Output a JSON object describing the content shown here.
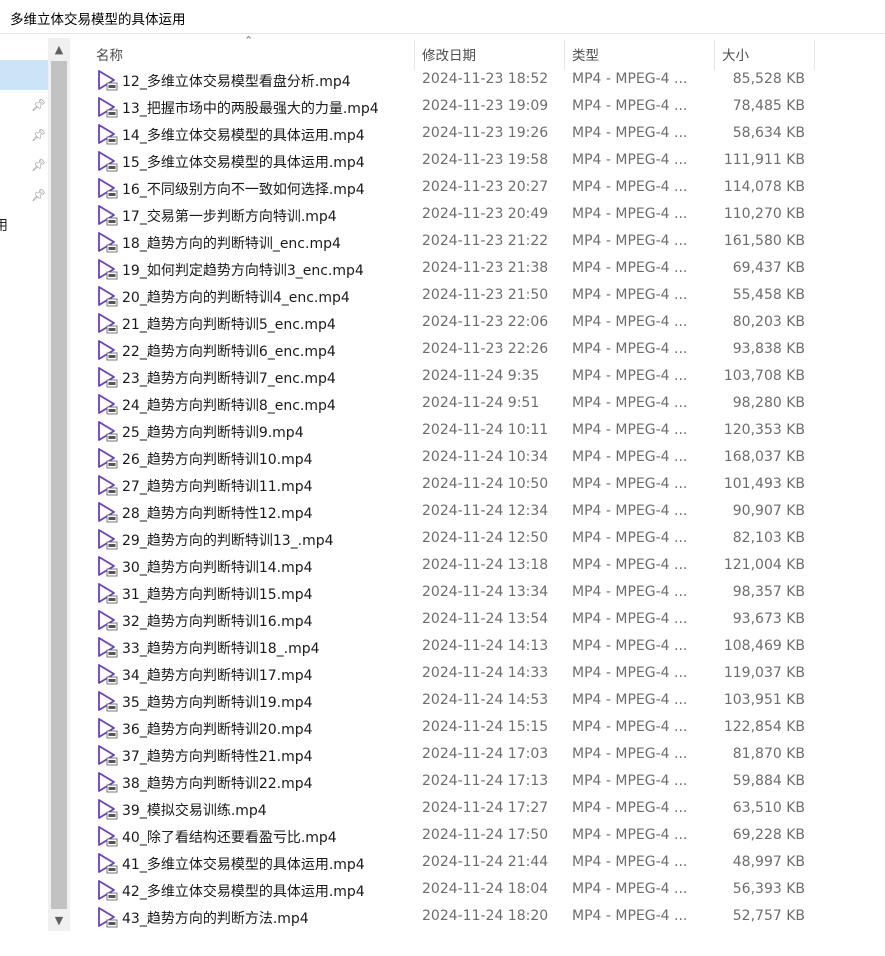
{
  "window": {
    "title": "多维立体交易模型的具体运用"
  },
  "nav": {
    "partial_label": "用"
  },
  "columns": {
    "name": "名称",
    "date": "修改日期",
    "type": "类型",
    "size": "大小"
  },
  "icons": {
    "file": "video-file-icon",
    "accent": "#6a3fc9",
    "pin": "pin-icon",
    "sort": "sort-up-icon"
  },
  "files": [
    {
      "name": "12_多维立体交易模型看盘分析.mp4",
      "date": "2024-11-23 18:52",
      "type": "MP4 - MPEG-4 ...",
      "size": "85,528 KB"
    },
    {
      "name": "13_把握市场中的两股最强大的力量.mp4",
      "date": "2024-11-23 19:09",
      "type": "MP4 - MPEG-4 ...",
      "size": "78,485 KB"
    },
    {
      "name": "14_多维立体交易模型的具体运用.mp4",
      "date": "2024-11-23 19:26",
      "type": "MP4 - MPEG-4 ...",
      "size": "58,634 KB"
    },
    {
      "name": "15_多维立体交易模型的具体运用.mp4",
      "date": "2024-11-23 19:58",
      "type": "MP4 - MPEG-4 ...",
      "size": "111,911 KB"
    },
    {
      "name": "16_不同级别方向不一致如何选择.mp4",
      "date": "2024-11-23 20:27",
      "type": "MP4 - MPEG-4 ...",
      "size": "114,078 KB"
    },
    {
      "name": "17_交易第一步判断方向特训.mp4",
      "date": "2024-11-23 20:49",
      "type": "MP4 - MPEG-4 ...",
      "size": "110,270 KB"
    },
    {
      "name": "18_趋势方向的判断特训_enc.mp4",
      "date": "2024-11-23 21:22",
      "type": "MP4 - MPEG-4 ...",
      "size": "161,580 KB"
    },
    {
      "name": "19_如何判定趋势方向特训3_enc.mp4",
      "date": "2024-11-23 21:38",
      "type": "MP4 - MPEG-4 ...",
      "size": "69,437 KB"
    },
    {
      "name": "20_趋势方向的判断特训4_enc.mp4",
      "date": "2024-11-23 21:50",
      "type": "MP4 - MPEG-4 ...",
      "size": "55,458 KB"
    },
    {
      "name": "21_趋势方向判断特训5_enc.mp4",
      "date": "2024-11-23 22:06",
      "type": "MP4 - MPEG-4 ...",
      "size": "80,203 KB"
    },
    {
      "name": "22_趋势方向判断特训6_enc.mp4",
      "date": "2024-11-23 22:26",
      "type": "MP4 - MPEG-4 ...",
      "size": "93,838 KB"
    },
    {
      "name": "23_趋势方向判断特训7_enc.mp4",
      "date": "2024-11-24 9:35",
      "type": "MP4 - MPEG-4 ...",
      "size": "103,708 KB"
    },
    {
      "name": "24_趋势方向判断特训8_enc.mp4",
      "date": "2024-11-24 9:51",
      "type": "MP4 - MPEG-4 ...",
      "size": "98,280 KB"
    },
    {
      "name": "25_趋势方向判断特训9.mp4",
      "date": "2024-11-24 10:11",
      "type": "MP4 - MPEG-4 ...",
      "size": "120,353 KB"
    },
    {
      "name": "26_趋势方向判断特训10.mp4",
      "date": "2024-11-24 10:34",
      "type": "MP4 - MPEG-4 ...",
      "size": "168,037 KB"
    },
    {
      "name": "27_趋势方向判断特训11.mp4",
      "date": "2024-11-24 10:50",
      "type": "MP4 - MPEG-4 ...",
      "size": "101,493 KB"
    },
    {
      "name": "28_趋势方向判断特性12.mp4",
      "date": "2024-11-24 12:34",
      "type": "MP4 - MPEG-4 ...",
      "size": "90,907 KB"
    },
    {
      "name": "29_趋势方向的判断特训13_.mp4",
      "date": "2024-11-24 12:50",
      "type": "MP4 - MPEG-4 ...",
      "size": "82,103 KB"
    },
    {
      "name": "30_趋势方向判断特训14.mp4",
      "date": "2024-11-24 13:18",
      "type": "MP4 - MPEG-4 ...",
      "size": "121,004 KB"
    },
    {
      "name": "31_趋势方向判断特训15.mp4",
      "date": "2024-11-24 13:34",
      "type": "MP4 - MPEG-4 ...",
      "size": "98,357 KB"
    },
    {
      "name": "32_趋势方向判断特训16.mp4",
      "date": "2024-11-24 13:54",
      "type": "MP4 - MPEG-4 ...",
      "size": "93,673 KB"
    },
    {
      "name": "33_趋势方向判断特训18_.mp4",
      "date": "2024-11-24 14:13",
      "type": "MP4 - MPEG-4 ...",
      "size": "108,469 KB"
    },
    {
      "name": "34_趋势方向判断特训17.mp4",
      "date": "2024-11-24 14:33",
      "type": "MP4 - MPEG-4 ...",
      "size": "119,037 KB"
    },
    {
      "name": "35_趋势方向判断特训19.mp4",
      "date": "2024-11-24 14:53",
      "type": "MP4 - MPEG-4 ...",
      "size": "103,951 KB"
    },
    {
      "name": "36_趋势方向判断特训20.mp4",
      "date": "2024-11-24 15:15",
      "type": "MP4 - MPEG-4 ...",
      "size": "122,854 KB"
    },
    {
      "name": "37_趋势方向判断特性21.mp4",
      "date": "2024-11-24 17:03",
      "type": "MP4 - MPEG-4 ...",
      "size": "81,870 KB"
    },
    {
      "name": "38_趋势方向判断特训22.mp4",
      "date": "2024-11-24 17:13",
      "type": "MP4 - MPEG-4 ...",
      "size": "59,884 KB"
    },
    {
      "name": "39_模拟交易训练.mp4",
      "date": "2024-11-24 17:27",
      "type": "MP4 - MPEG-4 ...",
      "size": "63,510 KB"
    },
    {
      "name": "40_除了看结构还要看盈亏比.mp4",
      "date": "2024-11-24 17:50",
      "type": "MP4 - MPEG-4 ...",
      "size": "69,228 KB"
    },
    {
      "name": "41_多维立体交易模型的具体运用.mp4",
      "date": "2024-11-24 21:44",
      "type": "MP4 - MPEG-4 ...",
      "size": "48,997 KB"
    },
    {
      "name": "42_多维立体交易模型的具体运用.mp4",
      "date": "2024-11-24 18:04",
      "type": "MP4 - MPEG-4 ...",
      "size": "56,393 KB"
    },
    {
      "name": "43_趋势方向的判断方法.mp4",
      "date": "2024-11-24 18:20",
      "type": "MP4 - MPEG-4 ...",
      "size": "52,757 KB"
    }
  ]
}
